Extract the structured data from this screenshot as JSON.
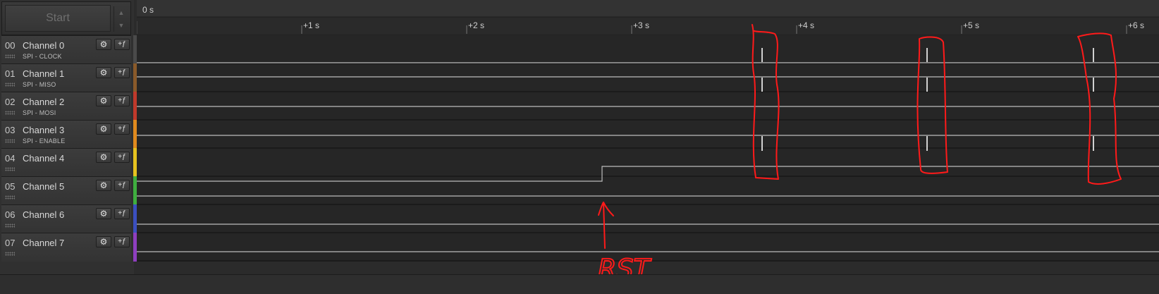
{
  "toolbar": {
    "start_label": "Start"
  },
  "timeline": {
    "origin_label": "0 s",
    "ticks": [
      "+1 s",
      "+2 s",
      "+3 s",
      "+4 s",
      "+5 s",
      "+6 s"
    ]
  },
  "channels": [
    {
      "num": "00",
      "name": "Channel 0",
      "sub": "SPI - CLOCK",
      "color": "#4a4a4a"
    },
    {
      "num": "01",
      "name": "Channel 1",
      "sub": "SPI - MISO",
      "color": "#8a5a2a"
    },
    {
      "num": "02",
      "name": "Channel 2",
      "sub": "SPI - MOSI",
      "color": "#c0392b"
    },
    {
      "num": "03",
      "name": "Channel 3",
      "sub": "SPI - ENABLE",
      "color": "#e08a1e"
    },
    {
      "num": "04",
      "name": "Channel 4",
      "sub": "",
      "color": "#e6c21f"
    },
    {
      "num": "05",
      "name": "Channel 5",
      "sub": "",
      "color": "#3fae3f"
    },
    {
      "num": "06",
      "name": "Channel 6",
      "sub": "",
      "color": "#3b4fbf"
    },
    {
      "num": "07",
      "name": "Channel 7",
      "sub": "",
      "color": "#8e3fbf"
    }
  ],
  "annotation": {
    "text": "RST",
    "color": "#ff0000"
  }
}
